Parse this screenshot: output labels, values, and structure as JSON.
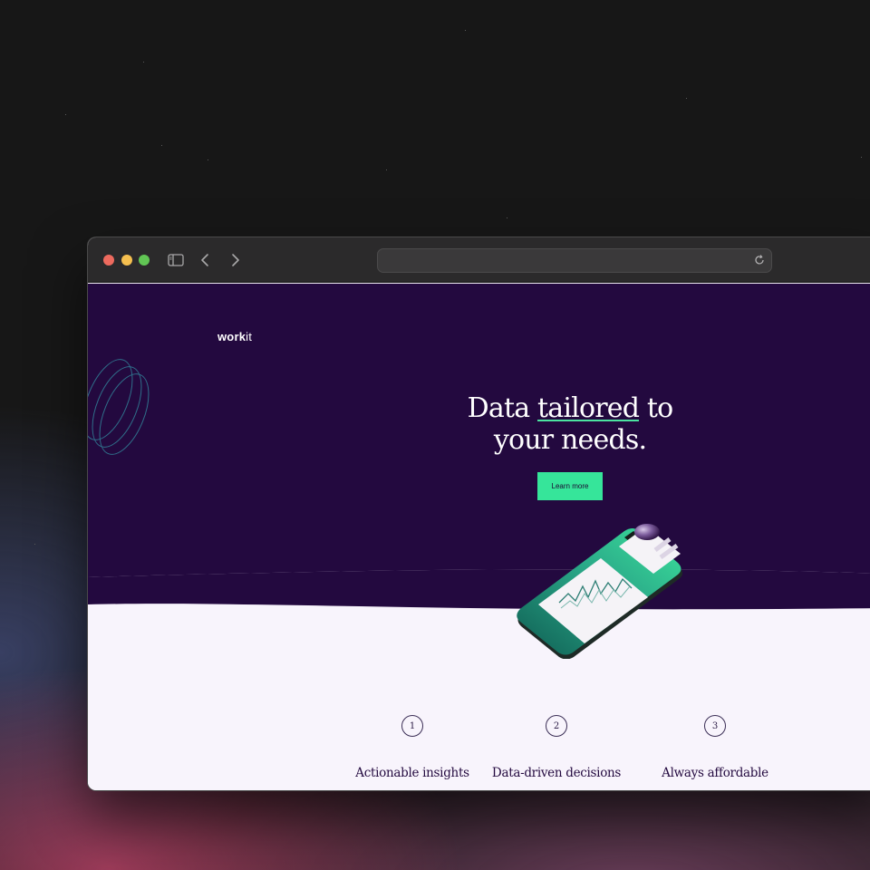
{
  "browser": {
    "address_value": ""
  },
  "site": {
    "logo_bold": "work",
    "logo_light": "it",
    "headline_line1_pre": "Data ",
    "headline_highlight": "tailored",
    "headline_line1_post": " to",
    "headline_line2": "your needs.",
    "cta_label": "Learn more",
    "accent_color": "#36e59a",
    "hero_color": "#23093f"
  },
  "features": [
    {
      "number": "1",
      "title": "Actionable insights"
    },
    {
      "number": "2",
      "title": "Data-driven decisions"
    },
    {
      "number": "3",
      "title": "Always affordable"
    }
  ]
}
